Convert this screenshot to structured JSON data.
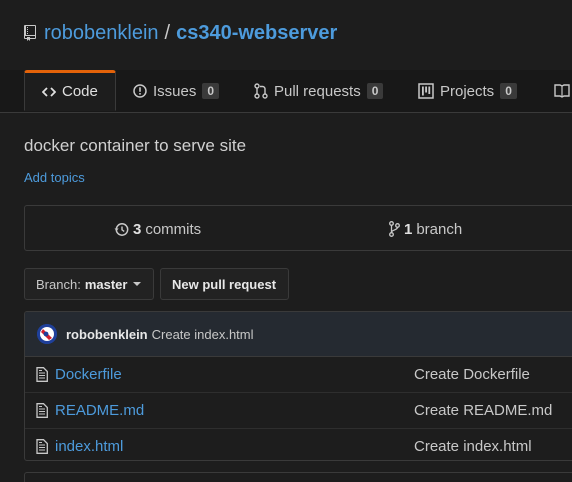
{
  "repo": {
    "owner": "robobenklein",
    "separator": "/",
    "name": "cs340-webserver"
  },
  "tabs": [
    {
      "label": "Code",
      "icon": "code-icon",
      "selected": true
    },
    {
      "label": "Issues",
      "icon": "issue-icon",
      "count": "0"
    },
    {
      "label": "Pull requests",
      "icon": "pull-request-icon",
      "count": "0"
    },
    {
      "label": "Projects",
      "icon": "project-icon",
      "count": "0"
    },
    {
      "label": "",
      "icon": "wiki-icon"
    }
  ],
  "description": "docker container to serve site",
  "add_topics": "Add topics",
  "summary": {
    "commits_count": "3",
    "commits_label": "commits",
    "branch_count": "1",
    "branch_label": "branch"
  },
  "branch_select": {
    "prefix": "Branch:",
    "value": "master"
  },
  "new_pull_request": "New pull request",
  "latest_commit": {
    "author": "robobenklein",
    "message": "Create index.html"
  },
  "files": [
    {
      "name": "Dockerfile",
      "commit_message": "Create Dockerfile"
    },
    {
      "name": "README.md",
      "commit_message": "Create README.md"
    },
    {
      "name": "index.html",
      "commit_message": "Create index.html"
    }
  ],
  "colors": {
    "link": "#4d9bdc",
    "selected_tab_accent": "#e36209",
    "background": "#1d1d1d"
  }
}
